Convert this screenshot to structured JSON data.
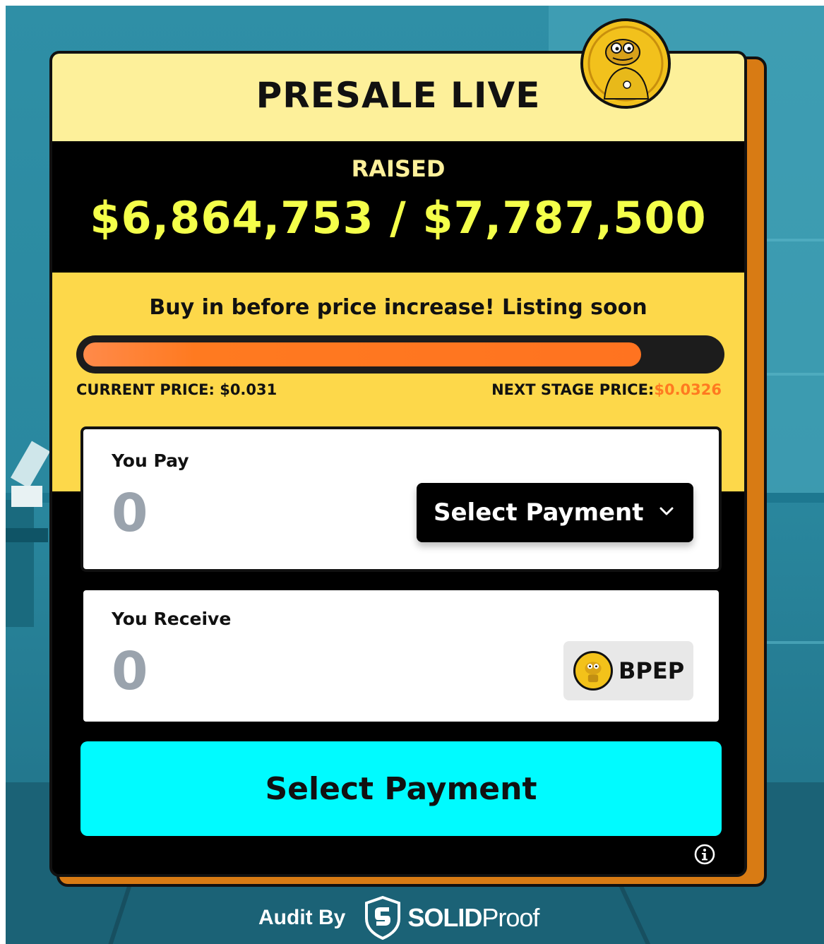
{
  "presale": {
    "title": "PRESALE LIVE",
    "raised_label": "RAISED",
    "raised_amount": "$6,864,753 / $7,787,500",
    "promo_text": "Buy in before price increase! Listing soon",
    "progress_percent": 88,
    "current_price_label": "CURRENT PRICE: $0.031",
    "next_stage_label": "NEXT STAGE PRICE:",
    "next_stage_value": "$0.0326"
  },
  "pay": {
    "label": "You Pay",
    "amount": "0",
    "select_label": "Select Payment"
  },
  "receive": {
    "label": "You Receive",
    "amount": "0",
    "token_symbol": "BPEP"
  },
  "cta": {
    "label": "Select Payment"
  },
  "footer": {
    "audit_label": "Audit By",
    "brand_strong": "SOLID",
    "brand_light": "Proof"
  },
  "colors": {
    "header_bg": "#fdf09a",
    "yellow_zone": "#fdd84a",
    "raised_amount": "#f4ff4a",
    "progress_fill": "#ff7a20",
    "cta_bg": "#00fbff",
    "next_stage_value": "#ff7a20"
  },
  "icons": {
    "avatar": "frog-mascot-avatar",
    "chevron": "chevron-down-icon",
    "token": "bpep-coin-icon",
    "info": "info-icon",
    "audit_logo": "solidproof-shield-logo"
  }
}
